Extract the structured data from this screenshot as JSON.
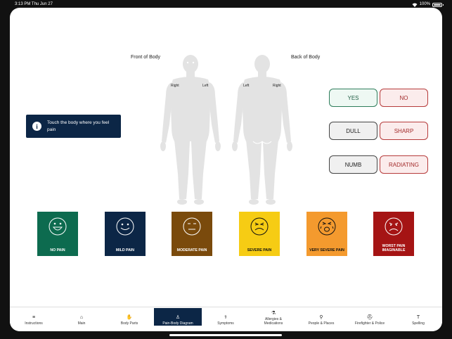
{
  "status_bar": {
    "time_date": "3:13 PM   Thu Jun 27",
    "battery": "100%"
  },
  "body_diagram": {
    "front_title": "Front of Body",
    "back_title": "Back of Body",
    "front_right": "Right",
    "front_left": "Left",
    "back_left": "Left",
    "back_right": "Right"
  },
  "info": {
    "icon": "i",
    "text": "Touch the body where you feel pain"
  },
  "answers": [
    {
      "label": "YES",
      "style": "green"
    },
    {
      "label": "NO",
      "style": "red"
    },
    {
      "label": "DULL",
      "style": "gray"
    },
    {
      "label": "SHARP",
      "style": "red"
    },
    {
      "label": "NUMB",
      "style": "gray"
    },
    {
      "label": "RADIATING",
      "style": "red"
    }
  ],
  "pain_scale": [
    {
      "label": "NO PAIN",
      "color": "#0d6b4f",
      "text_color": "#ffffff",
      "face": "big-smile"
    },
    {
      "label": "MILD PAIN",
      "color": "#0c2646",
      "text_color": "#ffffff",
      "face": "smile"
    },
    {
      "label": "MODERATE PAIN",
      "color": "#7a4a0c",
      "text_color": "#ffffff",
      "face": "neutral"
    },
    {
      "label": "SEVERE PAIN",
      "color": "#f6cc14",
      "text_color": "#111111",
      "face": "grimace"
    },
    {
      "label": "VERY SEVERE PAIN",
      "color": "#f49a2e",
      "text_color": "#111111",
      "face": "cry"
    },
    {
      "label": "WORST PAIN IMAGINABLE",
      "color": "#a51414",
      "text_color": "#ffffff",
      "face": "frown"
    }
  ],
  "tabs": [
    {
      "label": "Instructions",
      "icon": "≡"
    },
    {
      "label": "Main",
      "icon": "⌂"
    },
    {
      "label": "Body Parts",
      "icon": "✋"
    },
    {
      "label": "Pain-Body Diagram",
      "icon": "♙",
      "active": true
    },
    {
      "label": "Symptoms",
      "icon": "⚕"
    },
    {
      "label": "Allergies &\nMedications",
      "icon": "⚗"
    },
    {
      "label": "People & Places",
      "icon": "⚲"
    },
    {
      "label": "Firefighter & Police",
      "icon": "⛑"
    },
    {
      "label": "Spelling",
      "icon": "T"
    }
  ]
}
